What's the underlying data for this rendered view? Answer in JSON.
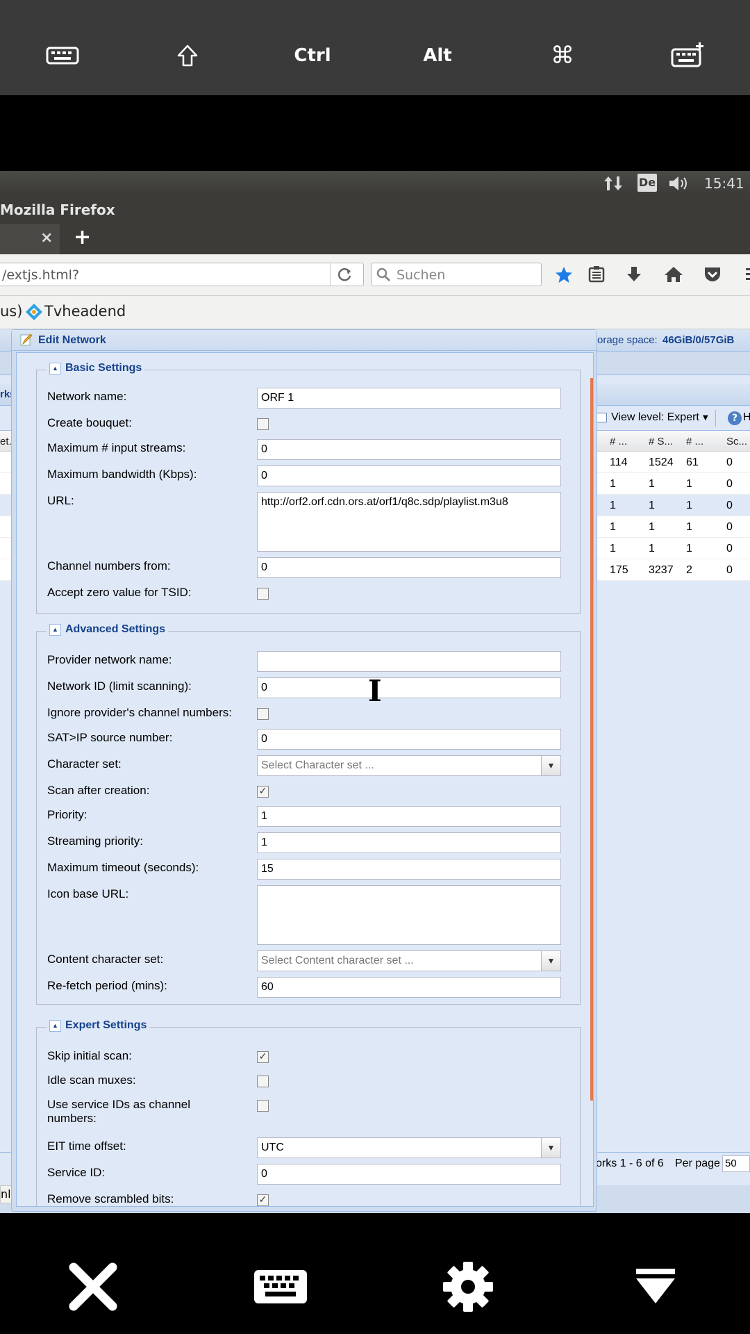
{
  "keyboard_bar": {
    "ctrl": "Ctrl",
    "alt": "Alt",
    "cmd_symbol": "⌘"
  },
  "system_panel": {
    "lang": "De",
    "time": "15:41"
  },
  "browser": {
    "title": "Mozilla Firefox",
    "tab_close": "×",
    "new_tab": "+",
    "url": "/extjs.html?",
    "search_placeholder": "Suchen",
    "bookmark_left": "us)",
    "bookmark_label": "Tvheadend",
    "status_url": "nl?#"
  },
  "background_grid": {
    "storage_prefix": "orage space: ",
    "storage_value": "46GiB/0/57GiB",
    "left_tab": "rks",
    "view_level": "View level: Expert",
    "help": "H",
    "col_left": "et...",
    "columns": [
      "# ...",
      "# S...",
      "# ...",
      "Sc..."
    ],
    "rows": [
      [
        "114",
        "1524",
        "61",
        "0"
      ],
      [
        "1",
        "1",
        "1",
        "0"
      ],
      [
        "1",
        "1",
        "1",
        "0"
      ],
      [
        "1",
        "1",
        "1",
        "0"
      ],
      [
        "1",
        "1",
        "1",
        "0"
      ],
      [
        "175",
        "3237",
        "2",
        "0"
      ]
    ],
    "pager_text": "orks 1 - 6 of 6",
    "per_page_label": "Per page",
    "per_page_value": "50"
  },
  "dialog": {
    "title": "Edit Network",
    "basic": {
      "legend": "Basic Settings",
      "network_name_label": "Network name:",
      "network_name_value": "ORF 1",
      "create_bouquet_label": "Create bouquet:",
      "max_streams_label": "Maximum # input streams:",
      "max_streams_value": "0",
      "max_bw_label": "Maximum bandwidth (Kbps):",
      "max_bw_value": "0",
      "url_label": "URL:",
      "url_value": "http://orf2.orf.cdn.ors.at/orf1/q8c.sdp/playlist.m3u8",
      "chan_from_label": "Channel numbers from:",
      "chan_from_value": "0",
      "zero_tsid_label": "Accept zero value for TSID:"
    },
    "advanced": {
      "legend": "Advanced Settings",
      "provider_name_label": "Provider network name:",
      "provider_name_value": "",
      "network_id_label": "Network ID (limit scanning):",
      "network_id_value": "0",
      "ignore_chan_label": "Ignore provider's channel numbers:",
      "satip_label": "SAT>IP source number:",
      "satip_value": "0",
      "charset_label": "Character set:",
      "charset_placeholder": "Select Character set ...",
      "scan_after_label": "Scan after creation:",
      "priority_label": "Priority:",
      "priority_value": "1",
      "stream_prio_label": "Streaming priority:",
      "stream_prio_value": "1",
      "timeout_label": "Maximum timeout (seconds):",
      "timeout_value": "15",
      "icon_url_label": "Icon base URL:",
      "icon_url_value": "",
      "content_charset_label": "Content character set:",
      "content_charset_placeholder": "Select Content character set ...",
      "refetch_label": "Re-fetch period (mins):",
      "refetch_value": "60"
    },
    "expert": {
      "legend": "Expert Settings",
      "skip_scan_label": "Skip initial scan:",
      "idle_scan_label": "Idle scan muxes:",
      "sid_chan_label_1": "Use service IDs as channel",
      "sid_chan_label_2": "numbers:",
      "eit_offset_label": "EIT time offset:",
      "eit_offset_value": "UTC",
      "service_id_label": "Service ID:",
      "service_id_value": "0",
      "remove_scrambled_label": "Remove scrambled bits:"
    },
    "checkboxes": {
      "create_bouquet": false,
      "zero_tsid": false,
      "ignore_chan": false,
      "scan_after": true,
      "skip_scan": true,
      "idle_scan": false,
      "sid_chan": false,
      "remove_scrambled": true
    }
  }
}
